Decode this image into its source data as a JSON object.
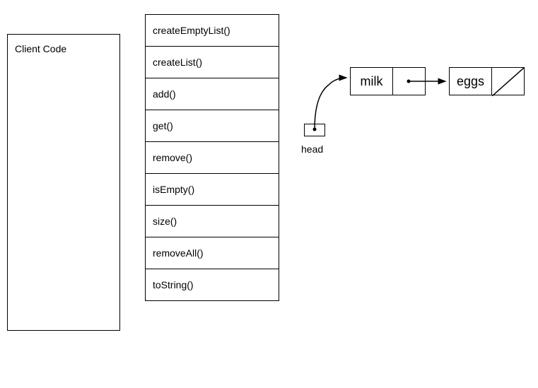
{
  "client": {
    "label": "Client Code"
  },
  "methods": [
    "createEmptyList()",
    "createList()",
    "add()",
    "get()",
    "remove()",
    "isEmpty()",
    "size()",
    "removeAll()",
    "toString()"
  ],
  "linkedList": {
    "headLabel": "head",
    "nodes": [
      {
        "value": "milk",
        "hasNext": true
      },
      {
        "value": "eggs",
        "hasNext": false
      }
    ]
  }
}
